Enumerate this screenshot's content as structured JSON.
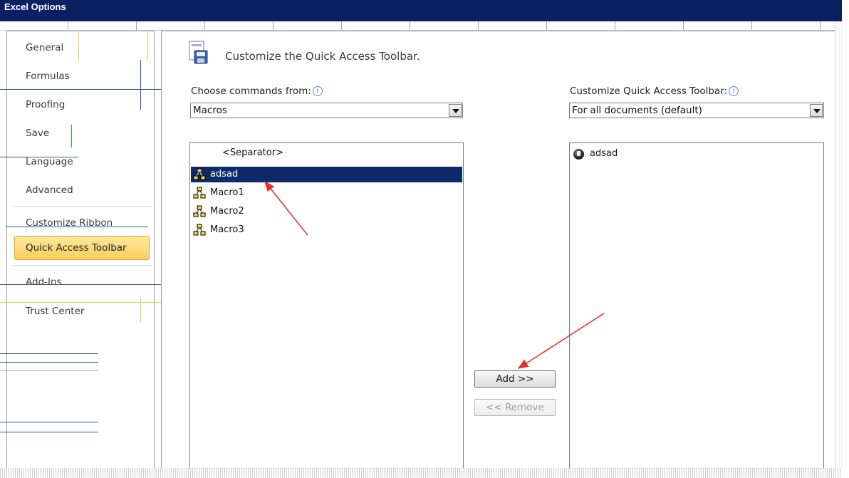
{
  "window": {
    "title": "Excel Options"
  },
  "nav": {
    "items": [
      {
        "label": "General"
      },
      {
        "label": "Formulas"
      },
      {
        "label": "Proofing"
      },
      {
        "label": "Save"
      },
      {
        "label": "Language"
      },
      {
        "label": "Advanced"
      },
      {
        "label": "Customize Ribbon"
      },
      {
        "label": "Quick Access Toolbar",
        "selected": true
      },
      {
        "label": "Add-Ins"
      },
      {
        "label": "Trust Center"
      }
    ]
  },
  "main": {
    "title": "Customize the Quick Access Toolbar.",
    "choose_label": "Choose commands from:",
    "choose_value": "Macros",
    "customize_label": "Customize Quick Access Toolbar:",
    "customize_value": "For all documents (default)",
    "commands": [
      {
        "label": "<Separator>",
        "type": "separator"
      },
      {
        "label": "adsad",
        "type": "macro",
        "selected": true
      },
      {
        "label": "Macro1",
        "type": "macro"
      },
      {
        "label": "Macro2",
        "type": "macro"
      },
      {
        "label": "Macro3",
        "type": "macro"
      }
    ],
    "toolbar_items": [
      {
        "label": "adsad"
      }
    ],
    "add_button": "Add >>",
    "remove_button": "<< Remove"
  },
  "colors": {
    "titlebar": "#0a2062",
    "selection": "#0f2a6a",
    "nav_selected_fill": "#f9cf5e",
    "nav_selected_border": "#e3a531",
    "annotation_arrow": "#e0302a"
  }
}
